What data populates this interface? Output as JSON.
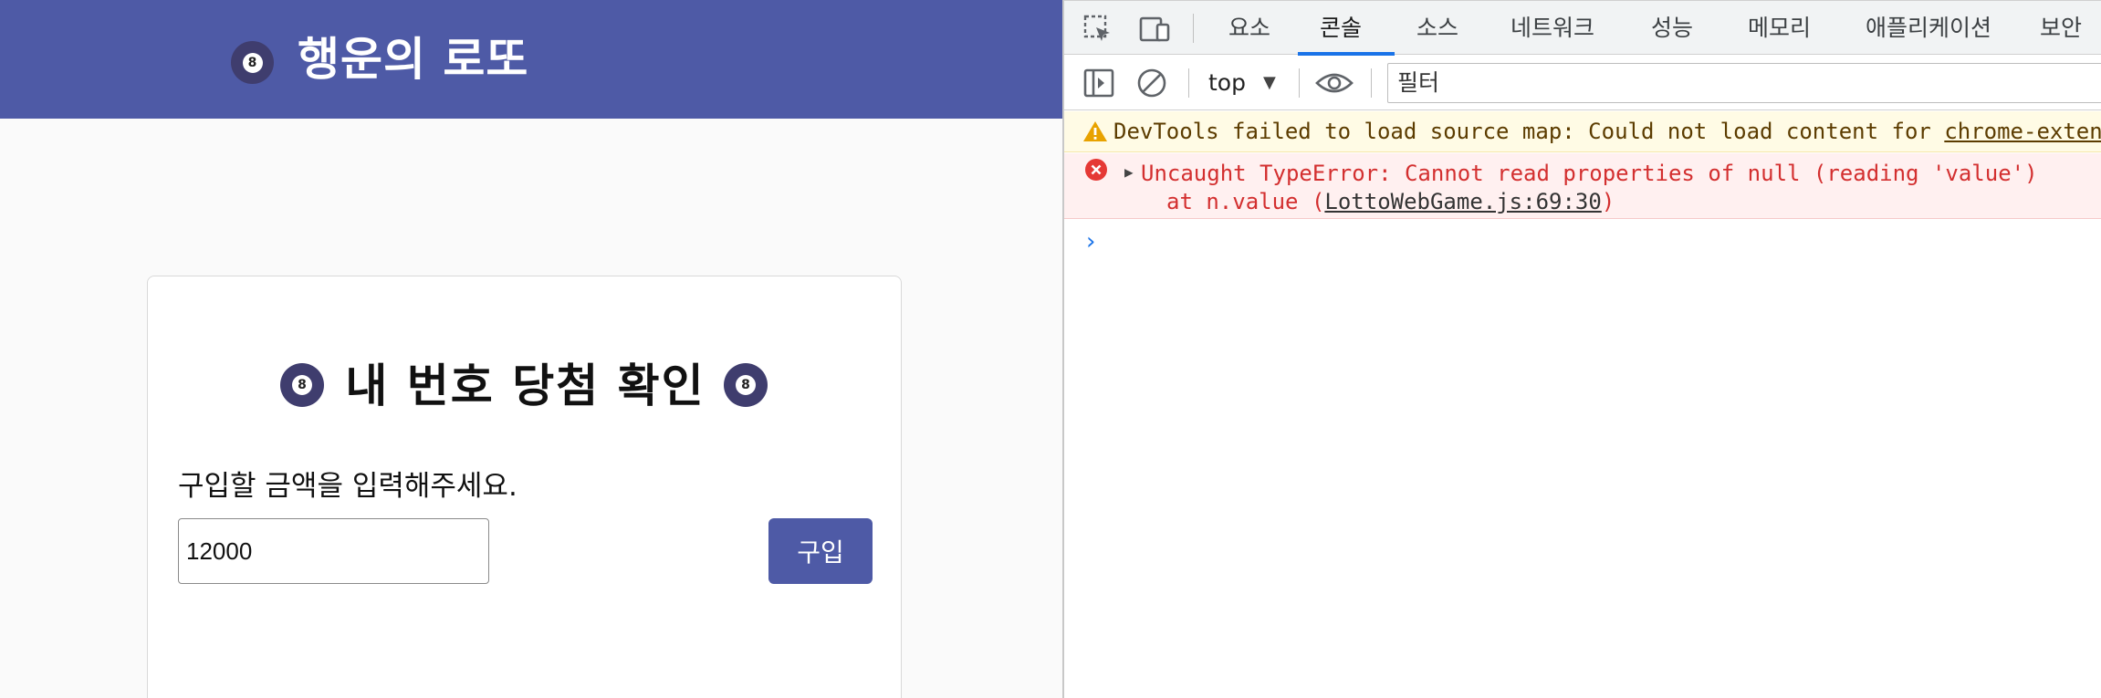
{
  "app": {
    "title": "행운의 로또",
    "ball_number": "8",
    "card": {
      "title": "내 번호 당첨 확인",
      "amount_label": "구입할 금액을 입력해주세요.",
      "amount_value": "12000",
      "buy_label": "구입"
    },
    "colors": {
      "header": "#4e5aa6",
      "button": "#4e5aa6",
      "ball": "#3f3d6e"
    }
  },
  "devtools": {
    "tabs": [
      {
        "label": "요소"
      },
      {
        "label": "콘솔"
      },
      {
        "label": "소스"
      },
      {
        "label": "네트워크"
      },
      {
        "label": "성능"
      },
      {
        "label": "메모리"
      },
      {
        "label": "애플리케이션"
      },
      {
        "label": "보안"
      }
    ],
    "active_tab": "콘솔",
    "context": "top",
    "filter_placeholder": "필터",
    "warning": {
      "text": "DevTools failed to load source map: Could not load content for ",
      "link": "chrome-extension"
    },
    "error": {
      "line1": "Uncaught TypeError: Cannot read properties of null (reading 'value')",
      "line2_prefix": "at n.value (",
      "link": "LottoWebGame.js:69:30",
      "line2_suffix": ")"
    },
    "prompt": "›",
    "icons": {
      "inspect": "inspect-element-icon",
      "device": "device-toolbar-icon",
      "sidebar": "sidebar-toggle-icon",
      "clear": "clear-console-icon",
      "eye": "live-expression-icon",
      "warning": "warning-icon",
      "error": "error-icon"
    }
  }
}
